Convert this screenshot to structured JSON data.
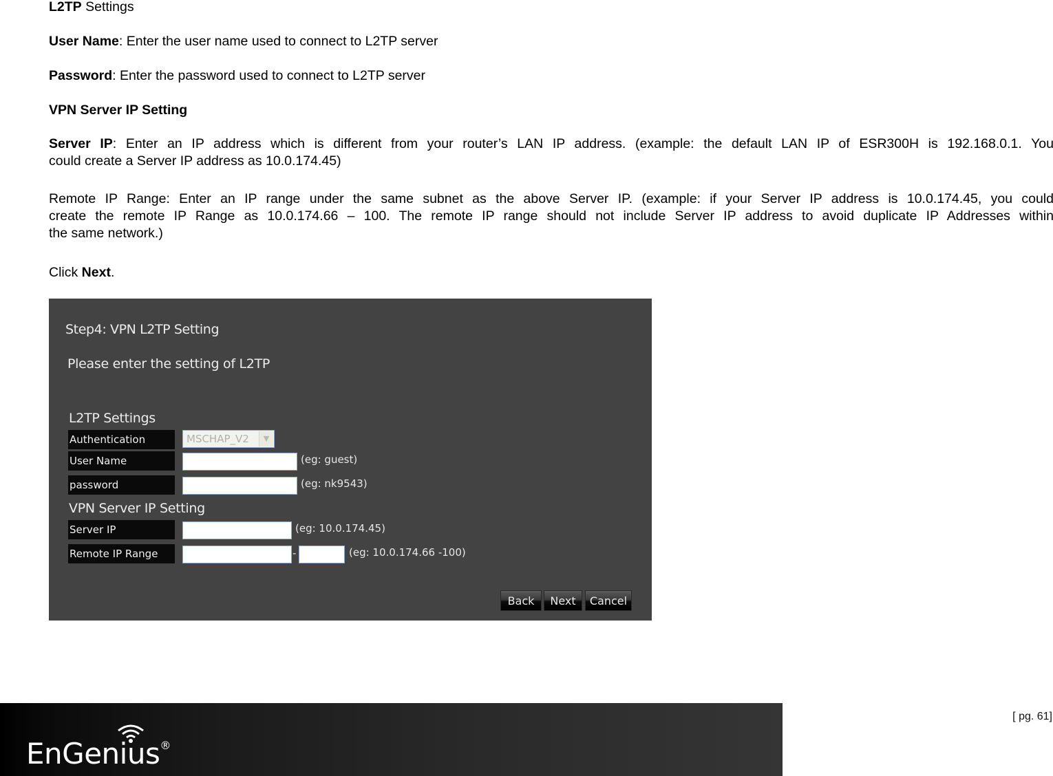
{
  "document": {
    "heading_l2tp": {
      "bold": "L2TP",
      "rest": " Settings"
    },
    "user_name": {
      "bold": "User Name",
      "rest": ": Enter the user name used to connect to L2TP server"
    },
    "password": {
      "bold": "Password",
      "rest": ": Enter the password used to connect to L2TP server"
    },
    "vpn_heading": "VPN Server IP Setting",
    "server_ip": {
      "bold": "Server IP",
      "line1_rest": ": Enter an IP address which is different from your router’s LAN IP address. (example: the default LAN IP of ESR300H is 192.168.0.1. You",
      "line2": "could create a Server IP address as 10.0.174.45)"
    },
    "remote_ip": {
      "line1": "Remote IP Range: Enter an IP range under the same subnet as the above Server IP. (example: if  your Server IP address is 10.0.174.45, you could",
      "line2": "create the remote IP Range as 10.0.174.66 – 100. The remote IP range should not include Server IP address to avoid duplicate IP Addresses within",
      "line3": "the same network.)"
    },
    "click_next": {
      "prefix": "Click ",
      "bold": "Next",
      "suffix": "."
    }
  },
  "panel": {
    "title": "Step4: VPN L2TP Setting",
    "subtitle": "Please enter the setting of L2TP",
    "l2tp_section": "L2TP Settings",
    "vpn_section": "VPN Server IP Setting",
    "fields": {
      "authentication": {
        "label": "Authentication",
        "value": "MSCHAP_V2"
      },
      "user_name": {
        "label": "User Name",
        "value": "",
        "hint": "(eg: guest)"
      },
      "password": {
        "label": "password",
        "value": "",
        "hint": "(eg: nk9543)"
      },
      "server_ip": {
        "label": "Server IP",
        "value": "",
        "hint": "(eg: 10.0.174.45)"
      },
      "remote_ip_range": {
        "label": "Remote IP Range",
        "start_value": "",
        "end_value": "",
        "separator": "-",
        "hint": "(eg: 10.0.174.66 -100)"
      }
    },
    "buttons": {
      "back": "Back",
      "next": "Next",
      "cancel": "Cancel"
    },
    "colors": {
      "panel_bg": "#434343",
      "label_bg": "#0a0a0a",
      "input_border": "#8faac8"
    }
  },
  "footer": {
    "brand": "EnGenius",
    "registered": "®",
    "page": "[ pg. 61]"
  }
}
